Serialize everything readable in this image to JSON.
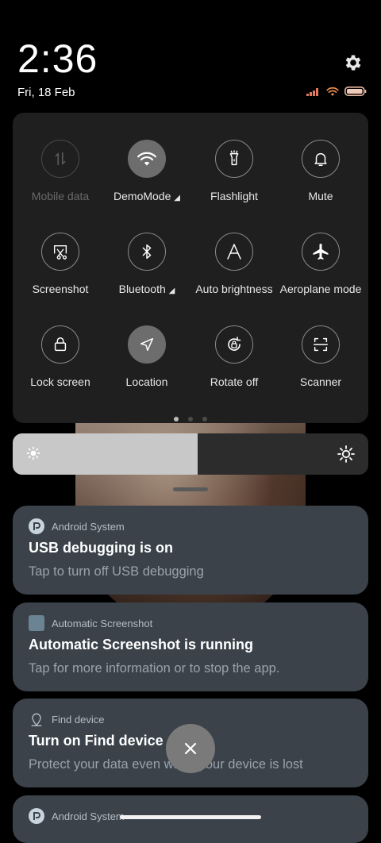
{
  "status": {
    "time": "2:36",
    "date": "Fri, 18 Feb"
  },
  "quick_settings": {
    "tiles": [
      {
        "label": "Mobile data",
        "icon": "mobile-data-icon",
        "state": "disabled"
      },
      {
        "label": "DemoMode",
        "icon": "wifi-icon",
        "state": "active",
        "expandable": true
      },
      {
        "label": "Flashlight",
        "icon": "flashlight-icon",
        "state": "off"
      },
      {
        "label": "Mute",
        "icon": "bell-icon",
        "state": "off"
      },
      {
        "label": "Screenshot",
        "icon": "screenshot-icon",
        "state": "off"
      },
      {
        "label": "Bluetooth",
        "icon": "bluetooth-icon",
        "state": "off",
        "expandable": true
      },
      {
        "label": "Auto brightness",
        "icon": "auto-brightness-icon",
        "state": "off"
      },
      {
        "label": "Aeroplane mode",
        "icon": "airplane-icon",
        "state": "off"
      },
      {
        "label": "Lock screen",
        "icon": "lock-icon",
        "state": "off"
      },
      {
        "label": "Location",
        "icon": "location-icon",
        "state": "active"
      },
      {
        "label": "Rotate off",
        "icon": "rotate-icon",
        "state": "off"
      },
      {
        "label": "Scanner",
        "icon": "scanner-icon",
        "state": "off"
      }
    ],
    "page_count": 3,
    "current_page": 1
  },
  "brightness": {
    "level": 0.52
  },
  "notifications": [
    {
      "app": "Android System",
      "title": "USB debugging is on",
      "body": "Tap to turn off USB debugging"
    },
    {
      "app": "Automatic Screenshot",
      "title": "Automatic Screenshot is running",
      "body": "Tap for more information or to stop the app."
    },
    {
      "app": "Find device",
      "title": "Turn on Find device",
      "body": "Protect your data even when your device is lost"
    },
    {
      "app": "Android System"
    }
  ],
  "colors": {
    "panel": "#1f1f1f",
    "notification": "#3b424a",
    "active_tile": "#6d6d6d"
  }
}
